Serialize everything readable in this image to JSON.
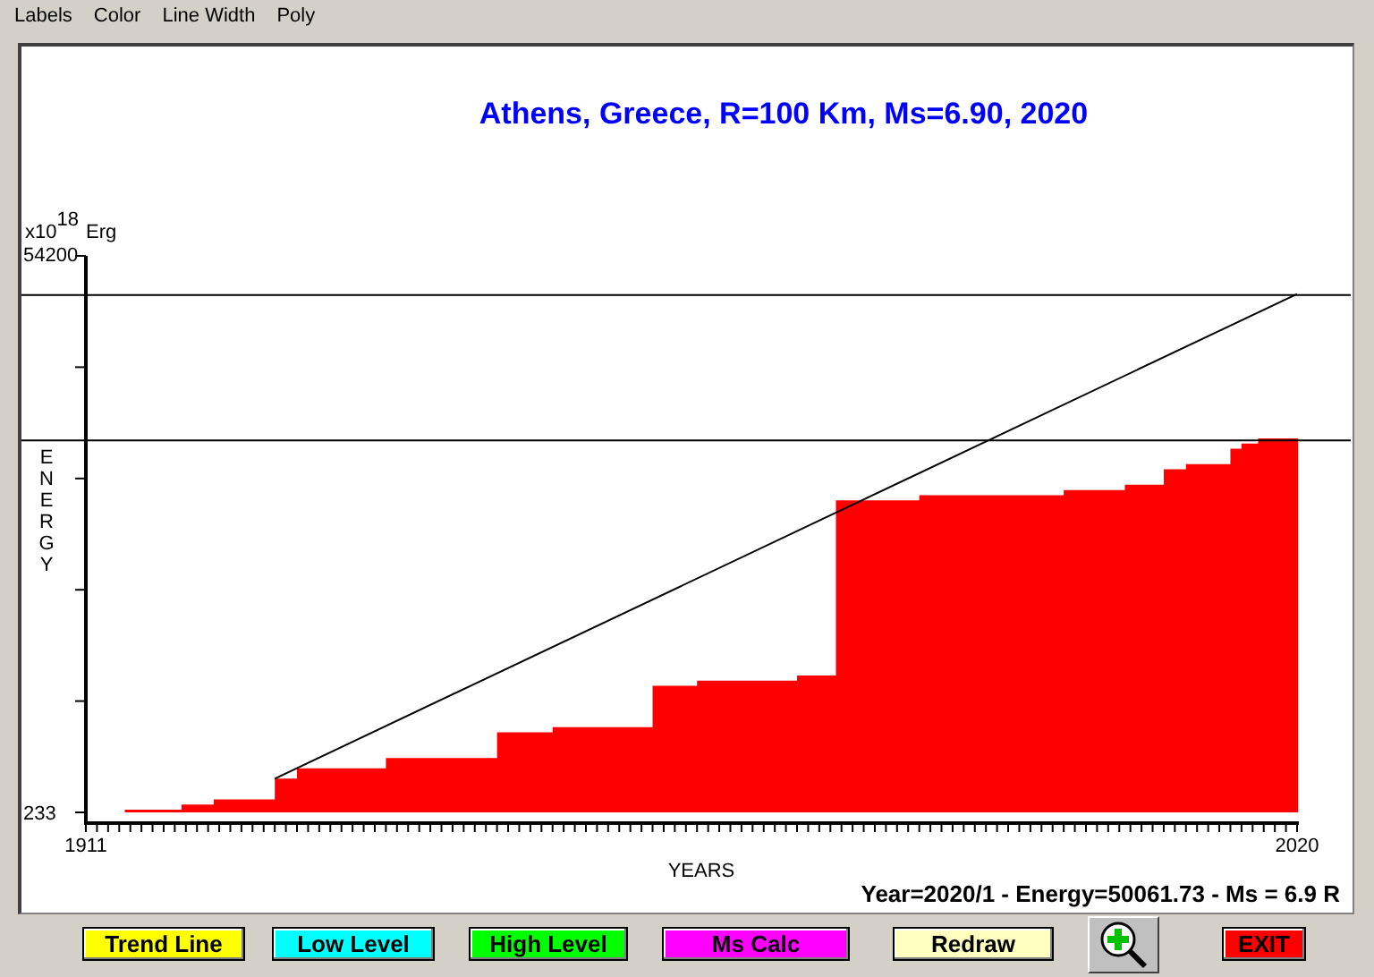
{
  "menu": [
    {
      "label": "Labels"
    },
    {
      "label": "Color"
    },
    {
      "label": "Line Width"
    },
    {
      "label": "Poly"
    }
  ],
  "chart": {
    "unit_base": "x10",
    "unit_exponent": "18",
    "unit": "Erg",
    "ylabel_vertical": "ENERGY",
    "status": "Year=2020/1 - Energy=50061.73 - Ms = 6.9 R",
    "chart_data": {
      "type": "area",
      "title": "Athens, Greece, R=100 Km, Ms=6.90, 2020",
      "xlabel": "YEARS",
      "x": [
        1914.5,
        1919.6,
        1922.5,
        1928,
        1930,
        1938,
        1948,
        1953,
        1962,
        1966,
        1975,
        1978.5,
        1986,
        1990.5,
        1999,
        2004.5,
        2008,
        2010,
        2014,
        2015,
        2016.5,
        2020
      ],
      "series": [
        {
          "color": "#ff0000",
          "values": [
            500,
            1000,
            1500,
            3500,
            4500,
            5500,
            8000,
            8500,
            12500,
            13000,
            13500,
            30500,
            31000,
            31000,
            31500,
            32000,
            33500,
            34000,
            35500,
            36000,
            36500,
            36500
          ]
        },
        {
          "type": "line",
          "color": "#000000",
          "values": [
            null,
            null,
            null,
            3500,
            null,
            null,
            null,
            null,
            null,
            null,
            null,
            null,
            null,
            null,
            null,
            null,
            null,
            null,
            null,
            null,
            null,
            50500
          ]
        }
      ],
      "xlim": [
        1911,
        2020
      ],
      "ylim": [
        233,
        54200
      ],
      "xticks": [
        1911,
        2020
      ],
      "yticks": [
        233,
        54200
      ],
      "ref_lines": [
        {
          "axis": "y",
          "value": 50400
        },
        {
          "axis": "y",
          "value": 36300
        }
      ]
    }
  },
  "buttons": [
    {
      "kind": "text",
      "label": "Trend Line",
      "color": "#ffff00"
    },
    {
      "kind": "text",
      "label": "Low Level",
      "color": "#00ffff"
    },
    {
      "kind": "text",
      "label": "High Level",
      "color": "#00ff00"
    },
    {
      "kind": "text",
      "label": "Ms Calc",
      "color": "#ff00ff"
    },
    {
      "kind": "text",
      "label": "Redraw",
      "color": "#ffffc0"
    },
    {
      "kind": "zoom"
    },
    {
      "kind": "text",
      "label": "EXIT",
      "color": "#ff0000"
    }
  ]
}
